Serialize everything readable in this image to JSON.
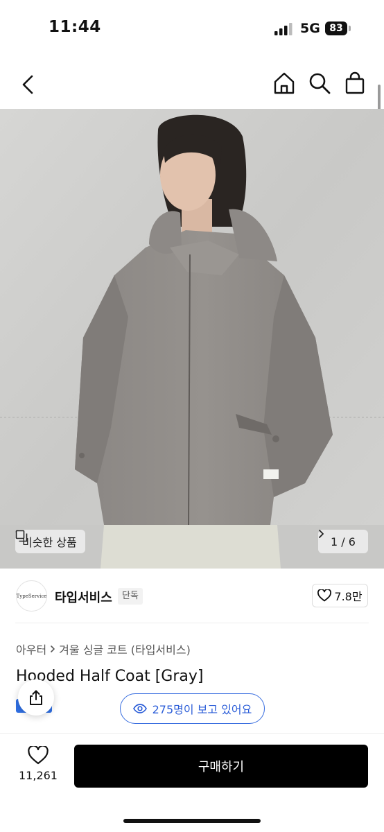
{
  "status_bar": {
    "time": "11:44",
    "network": "5G",
    "battery": "83"
  },
  "nav": {
    "icons": [
      "back-icon",
      "home-icon",
      "search-icon",
      "shopping-bag-icon"
    ]
  },
  "hero": {
    "similar_label": "비슷한 상품",
    "page_indicator": "1 / 6",
    "image_description_colors": {
      "wall": "#cfcfcd",
      "coat": "#8a8784"
    }
  },
  "brand": {
    "logo_text": "TypeService",
    "name": "타입서비스",
    "tag": "단독",
    "likes": "7.8만"
  },
  "product": {
    "breadcrumb": [
      "아우터",
      "겨울 싱글 코트 (타입서비스)"
    ],
    "title": "Hooded Half Coat [Gray]",
    "live_viewers": "275명이 보고 있어요"
  },
  "bottom_bar": {
    "wish_count": "11,261",
    "buy_label": "구매하기"
  },
  "colors": {
    "accent_blue": "#2f6fe3",
    "buy_button": "#000000"
  }
}
